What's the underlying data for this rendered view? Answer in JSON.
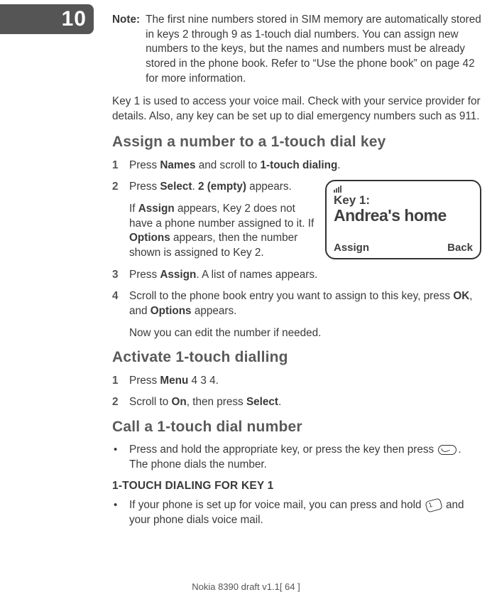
{
  "page_tab": "10",
  "note": {
    "label": "Note:",
    "text": "The first nine numbers stored in SIM memory are automatically stored in keys 2 through 9 as 1-touch dial numbers. You can assign new numbers to the keys, but the names and numbers must be already stored in the phone book. Refer to “Use the phone book” on page 42 for more information."
  },
  "intro": "Key 1 is used to access your voice mail. Check with your service provider for details. Also, any key can be set up to dial emergency numbers such as 911.",
  "sec1": {
    "heading": "Assign a number to a 1-touch dial key",
    "steps": {
      "s1": {
        "num": "1",
        "a": "Press ",
        "b1": "Names",
        "c": " and scroll to ",
        "b2": "1-touch dialing",
        "d": "."
      },
      "s2": {
        "num": "2",
        "a": "Press ",
        "b1": "Select",
        "c": ". ",
        "b2": "2 (empty)",
        "d": " appears."
      },
      "s2b": {
        "a": "If ",
        "b1": "Assign",
        "c": " appears, Key 2 does not have a phone number assigned to it. If ",
        "b2": "Options",
        "d": " appears, then the number shown is assigned to Key 2."
      },
      "s3": {
        "num": "3",
        "a": "Press ",
        "b1": "Assign",
        "c": ". A list of names appears."
      },
      "s4": {
        "num": "4",
        "a": "Scroll to the phone book entry you want to assign to this key, press ",
        "b1": "OK",
        "c": ", and ",
        "b2": "Options",
        "d": " appears."
      },
      "s4b": "Now you can edit the number if needed."
    }
  },
  "screen": {
    "title": "Key 1:",
    "big": "Andrea's home",
    "left": "Assign",
    "right": "Back"
  },
  "sec2": {
    "heading": "Activate 1-touch dialling",
    "steps": {
      "s1": {
        "num": "1",
        "a": "Press ",
        "b1": "Menu",
        "c": " 4 3 4."
      },
      "s2": {
        "num": "2",
        "a": "Scroll to ",
        "b1": "On",
        "c": ", then press ",
        "b2": "Select",
        "d": "."
      }
    }
  },
  "sec3": {
    "heading": "Call a 1-touch dial number",
    "bullet": {
      "a": "Press and hold the appropriate key, or press the key then press ",
      "b": ". The phone dials the number."
    },
    "sub_heading": "1-TOUCH DIALING FOR KEY 1",
    "bullet2": {
      "a": "If your phone is set up for voice mail, you can press and hold ",
      "b": " and your phone dials voice mail."
    }
  },
  "footer": "Nokia 8390 draft v1.1[ 64 ]"
}
